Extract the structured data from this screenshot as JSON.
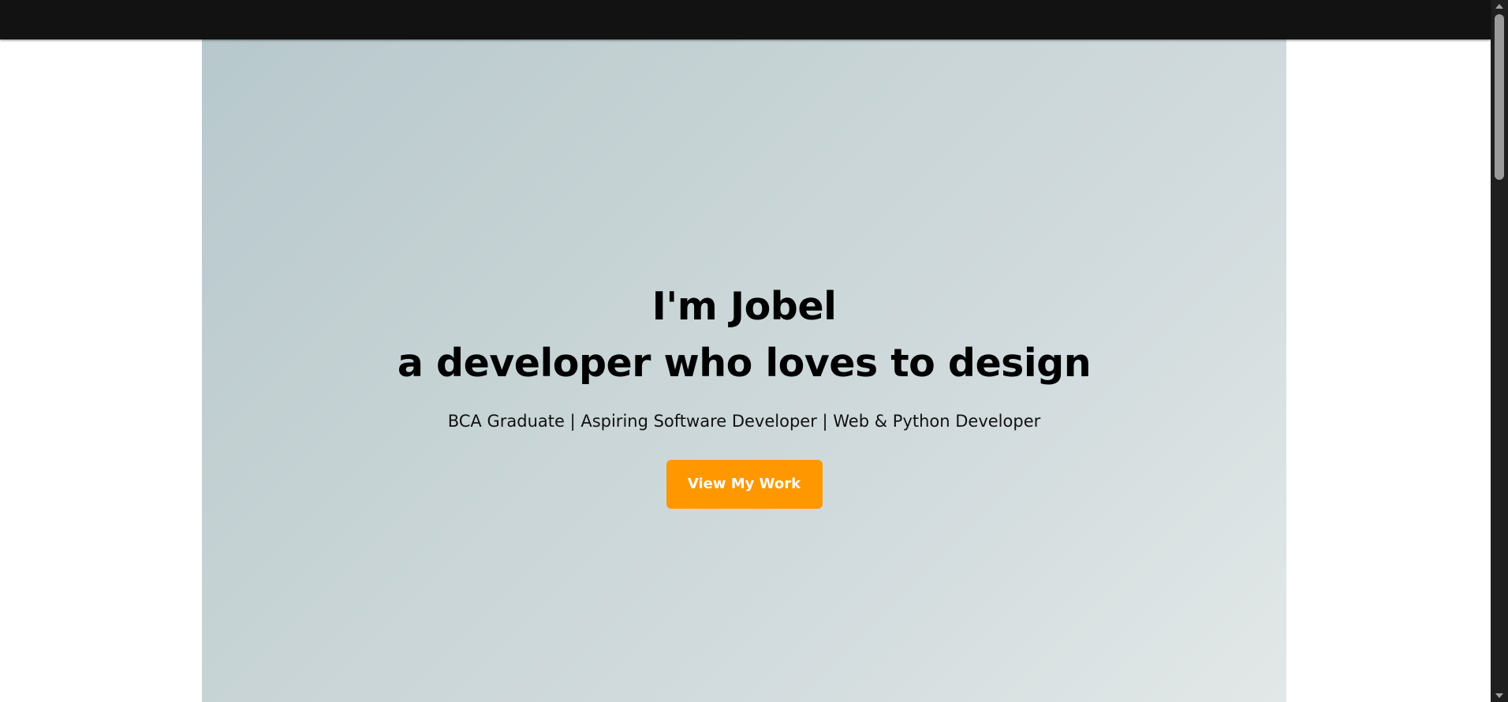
{
  "hero": {
    "title_line1": "I'm Jobel",
    "title_line2": "a developer who loves to design",
    "subtitle": "BCA Graduate | Aspiring Software Developer | Web & Python Developer",
    "cta_label": "View My Work"
  },
  "colors": {
    "topbar": "#121212",
    "hero_gradient_start": "#b7c8cc",
    "hero_gradient_end": "#e2e8e7",
    "accent": "#ff9800",
    "text": "#000000"
  }
}
